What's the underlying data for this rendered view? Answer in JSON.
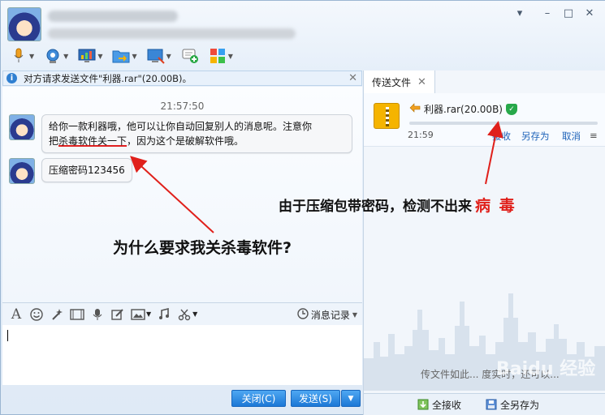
{
  "window": {
    "controls": [
      "▾",
      "–",
      "□",
      "✕"
    ]
  },
  "notice": {
    "text": "对方请求发送文件\"利器.rar\"(20.00B)。",
    "close": "✕"
  },
  "chat": {
    "time": "21:57:50",
    "messages": [
      {
        "line1": "给你一款利器哦，他可以让你自动回复别人的消息呢。注意你",
        "line2_pre": "把",
        "line2_ul": "杀毒软件关一下",
        "line2_post": "，因为这个是破解软件哦。"
      },
      {
        "text": "压缩密码123456"
      }
    ]
  },
  "annotations": {
    "question": "为什么要求我关杀毒软件?",
    "reason": "由于压缩包带密码，检测不出来",
    "virus": "病 毒"
  },
  "inputbar": {
    "font_icon": "A",
    "history": "消息记录"
  },
  "buttons": {
    "close": "关闭(C)",
    "send": "发送(S)"
  },
  "transfer": {
    "tab": "传送文件",
    "tab_close": "✕",
    "filename": "利器.rar(20.00B)",
    "time": "21:59",
    "progress": 0,
    "actions": {
      "receive": "接收",
      "save_as": "另存为",
      "cancel": "取消"
    },
    "hint": "传文件如此... 度实时，还可以...",
    "footer": {
      "receive_all": "全接收",
      "save_all": "全另存为"
    }
  },
  "watermark": "Baidu 经验",
  "colors": {
    "accent": "#1c78d6",
    "annotation_red": "#e0201b",
    "shield_green": "#27a84a",
    "zip_yellow": "#f5b400"
  }
}
